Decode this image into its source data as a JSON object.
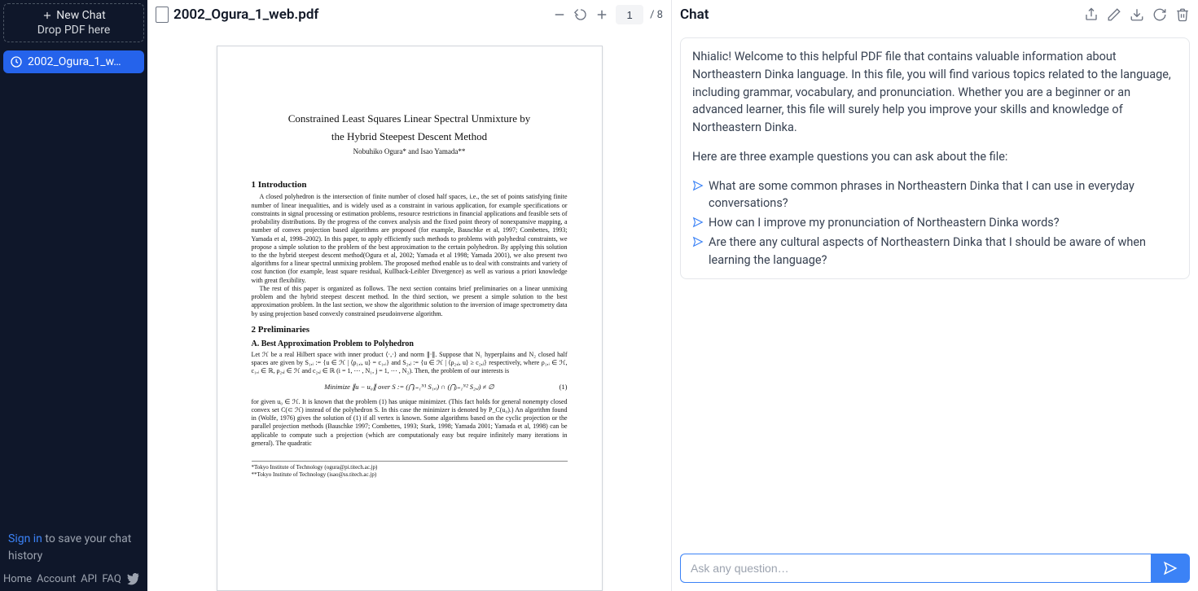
{
  "sidebar": {
    "new_chat_label": "New Chat",
    "drop_hint": "Drop PDF here",
    "active_chat_title": "2002_Ogura_1_w…",
    "signin_link": "Sign in",
    "signin_rest": " to save your chat history",
    "footer": {
      "home": "Home",
      "account": "Account",
      "api": "API",
      "faq": "FAQ"
    }
  },
  "pdf": {
    "filename": "2002_Ogura_1_web.pdf",
    "current_page": "1",
    "total_pages": "/ 8",
    "paper": {
      "title_l1": "Constrained Least Squares Linear Spectral Unmixture by",
      "title_l2": "the Hybrid Steepest Descent Method",
      "authors": "Nobuhiko Ogura*  and Isao Yamada**",
      "sec1": "1    Introduction",
      "intro_p1": "A closed polyhedron is the intersection of finite number of closed half spaces, i.e., the set of points satisfying finite number of linear inequalities, and is widely used as a constraint in various application, for example specifications or constraints in signal processing or estimation problems, resource restrictions in financial applications and feasible sets of probability distributions. By the progress of the convex analysis and the fixed point theory of nonexpansive mapping, a number of convex projection based algorithms are proposed (for example, Bauschke et al, 1997; Combettes, 1993; Yamada et al, 1998–2002). In this paper, to apply efficiently such methods to problems with polyhedral constraints, we propose a simple solution to the problem of the best approximation to the certain polyhedron. By applying this solution to the the hybrid steepest descent method(Ogura et al, 2002; Yamada et al 1998; Yamada 2001), we also present two algorithms for a linear spectral unmixing problem. The proposed method enable us to deal with constraints and variety of cost function (for example, least square residual, Kullback-Leibler Divergence) as well as various a priori knowledge with great flexibility.",
      "intro_p2": "The rest of this paper is organized as follows. The next section contains brief preliminaries on a linear unmixing problem and the hybrid steepest descent method. In the third section, we present a simple solution to the best approximation problem. In the last section, we show the algorithmic solution to the inversion of image spectrometry data by using projection based convexly constrained pseudoinverse algorithm.",
      "sec2": "2    Preliminaries",
      "secA": "A. Best Approximation Problem to Polyhedron",
      "prelim_p1": "Let ℋ be a real Hilbert space with inner product ⟨·,·⟩ and norm ∥·∥. Suppose that N₁ hyperplains and N₂ closed half spaces are given by S₁,ᵢ := {u ∈ ℋ | ⟨ρ₁,ᵢ, u⟩ = c₁,ᵢ} and S₂,ⱼ := {u ∈ ℋ | ⟨ρ₂,ⱼ, u⟩ ≥ c₂,ⱼ} respectively, where ρ₁,ᵢ ∈ ℋ, c₁,ᵢ ∈ ℝ, ρ₂,ⱼ ∈ ℋ and c₂,ⱼ ∈ ℝ (i = 1, ⋯ , N₁, j = 1, ⋯ , N₂). Then, the problem of our interests is",
      "eq1": "Minimize ∥u − u₀∥ over S := (⋂ᵢ₌₁ᴺ¹ S₁,ᵢ) ∩ (⋂ⱼ₌₁ᴺ² S₂,ⱼ) ≠ ∅",
      "eq1_no": "(1)",
      "prelim_p2": "for given u₀ ∈ ℋ. It is known that the problem (1) has unique minimizer. (This fact holds for general nonempty closed convex set C(⊂ ℋ) instead of the polyhedron S. In this case the minimizer is denoted by P_C(u₀).) An algorithm found in (Wolfe, 1976) gives the solution of (1) if all vertex is known. Some algorithms based on the cyclic projection or the parallel projection methods (Bauschke 1997; Combettes, 1993; Stark, 1998; Yamada 2001; Yamada et al, 1998) can be applicable to compute such a projection (which are computationaly easy but require infinitely many iterations in general). The quadratic",
      "fn1": "*Tokyo Institute of Technology (ogura@pi.titech.ac.jp)",
      "fn2": "**Tokyo Institute of Technology (isao@ss.titech.ac.jp)"
    }
  },
  "chat": {
    "header": "Chat",
    "welcome_p1": "Nhialic! Welcome to this helpful PDF file that contains valuable information about Northeastern Dinka language. In this file, you will find various topics related to the language, including grammar, vocabulary, and pronunciation. Whether you are a beginner or an advanced learner, this file will surely help you improve your skills and knowledge of Northeastern Dinka.",
    "welcome_p2": "Here are three example questions you can ask about the file:",
    "q1": "What are some common phrases in Northeastern Dinka that I can use in everyday conversations?",
    "q2": "How can I improve my pronunciation of Northeastern Dinka words?",
    "q3": "Are there any cultural aspects of Northeastern Dinka that I should be aware of when learning the language?",
    "input_placeholder": "Ask any question…"
  }
}
